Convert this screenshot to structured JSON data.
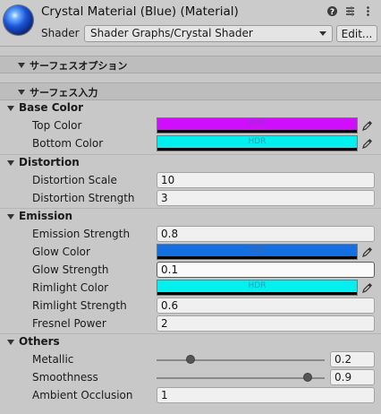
{
  "header": {
    "title": "Crystal Material (Blue) (Material)",
    "shader_label": "Shader",
    "shader_value": "Shader Graphs/Crystal Shader",
    "edit_label": "Edit...",
    "icons": [
      "help-icon",
      "preset-icon",
      "more-icon"
    ]
  },
  "sections": {
    "surface_options": "サーフェスオプション",
    "surface_inputs": "サーフェス入力"
  },
  "groups": {
    "base_color": {
      "label": "Base Color",
      "top_color_label": "Top Color",
      "top_color": "#d10dff",
      "bottom_color_label": "Bottom Color",
      "bottom_color": "#00f0f0",
      "hdr": "HDR"
    },
    "distortion": {
      "label": "Distortion",
      "scale_label": "Distortion Scale",
      "scale": "10",
      "strength_label": "Distortion Strength",
      "strength": "3"
    },
    "emission": {
      "label": "Emission",
      "emission_strength_label": "Emission Strength",
      "emission_strength": "0.8",
      "glow_color_label": "Glow Color",
      "glow_color": "#1470e0",
      "glow_strength_label": "Glow Strength",
      "glow_strength": "0.1",
      "rimlight_color_label": "Rimlight Color",
      "rimlight_color": "#00f0f0",
      "rimlight_strength_label": "Rimlight Strength",
      "rimlight_strength": "0.6",
      "fresnel_power_label": "Fresnel Power",
      "fresnel_power": "2",
      "hdr": "HDR"
    },
    "others": {
      "label": "Others",
      "metallic_label": "Metallic",
      "metallic": "0.2",
      "smoothness_label": "Smoothness",
      "smoothness": "0.9",
      "ao_label": "Ambient Occlusion",
      "ao": "1"
    }
  }
}
